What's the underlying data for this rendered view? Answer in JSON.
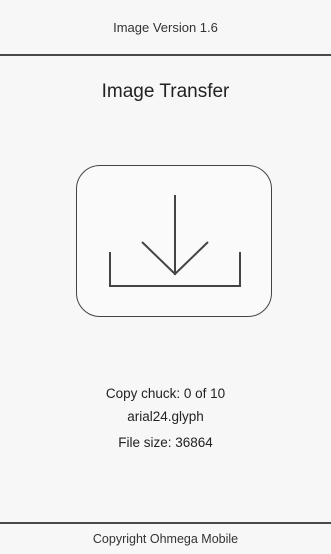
{
  "header": {
    "version_text": "Image Version 1.6"
  },
  "main": {
    "title": "Image Transfer",
    "download_icon": "download-icon",
    "copy_chunk": "Copy chuck: 0 of 10",
    "filename": "arial24.glyph",
    "file_size": "File size: 36864"
  },
  "footer": {
    "copyright": "Copyright Ohmega Mobile"
  }
}
